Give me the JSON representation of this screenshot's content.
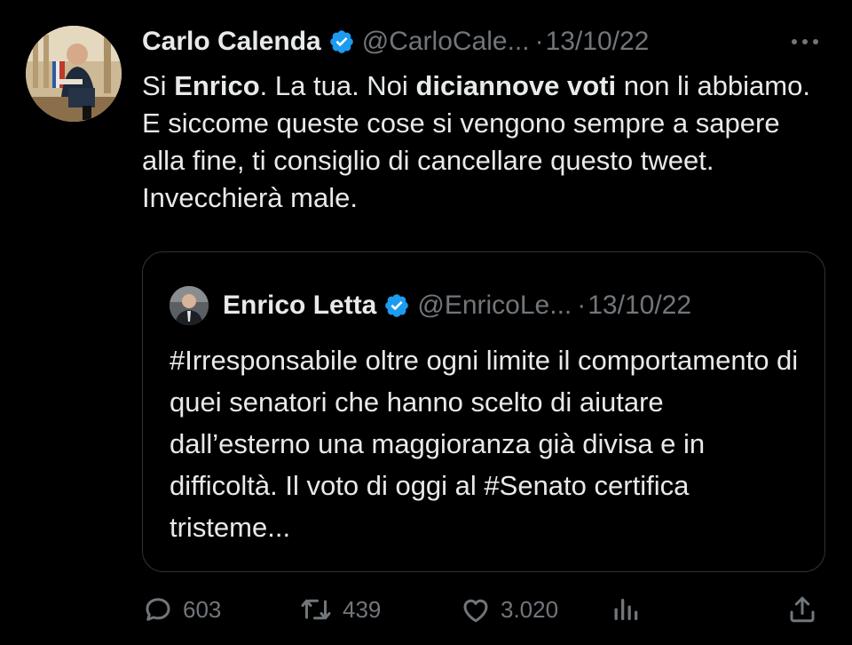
{
  "tweet": {
    "author_name": "Carlo Calenda",
    "handle": "@CarloCale...",
    "separator": "·",
    "date": "13/10/22",
    "text_segments": [
      {
        "t": "Si ",
        "b": false
      },
      {
        "t": "Enrico",
        "b": true
      },
      {
        "t": ". La tua. Noi ",
        "b": false
      },
      {
        "t": "diciannove voti",
        "b": true
      },
      {
        "t": " non li abbiamo. E siccome queste cose si vengono sempre a sapere alla fine, ti consiglio di cancellare questo tweet. Invecchierà male.",
        "b": false
      }
    ]
  },
  "quoted": {
    "author_name": "Enrico Letta",
    "handle": "@EnricoLe...",
    "separator": "·",
    "date": "13/10/22",
    "text": "#Irresponsabile oltre ogni limite il comportamento di quei senatori che hanno scelto di aiutare dall’esterno una maggioranza già divisa e in difficoltà. Il voto di oggi al #Senato certifica tristeme..."
  },
  "actions": {
    "replies": "603",
    "retweets": "439",
    "likes": "3.020"
  },
  "icons": {
    "verified": "verified-badge-icon",
    "more": "more-icon",
    "reply": "reply-icon",
    "retweet": "retweet-icon",
    "like": "heart-icon",
    "views": "views-icon",
    "share": "share-icon"
  },
  "colors": {
    "background": "#000000",
    "text": "#e7e9ea",
    "secondary": "#71767b",
    "verified": "#1d9bf0",
    "border": "#2f3336"
  }
}
